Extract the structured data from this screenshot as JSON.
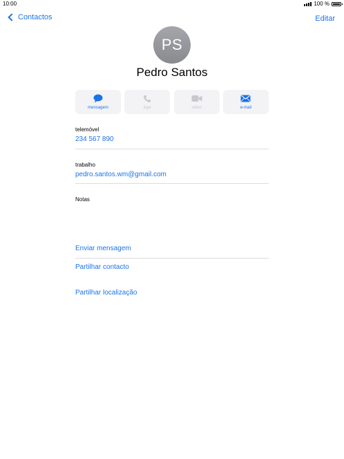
{
  "status_bar": {
    "time": "10:00",
    "battery": "100 %"
  },
  "nav": {
    "back_label": "Contactos",
    "edit_label": "Editar"
  },
  "contact": {
    "initials": "PS",
    "name": "Pedro Santos"
  },
  "actions": [
    {
      "label": "mensagem",
      "icon": "message-icon",
      "enabled": true
    },
    {
      "label": "ligar",
      "icon": "phone-icon",
      "enabled": false
    },
    {
      "label": "vídeo",
      "icon": "video-icon",
      "enabled": false
    },
    {
      "label": "e-mail",
      "icon": "mail-icon",
      "enabled": true
    }
  ],
  "fields": {
    "phone": {
      "label": "telemóvel",
      "value": "234 567 890"
    },
    "email": {
      "label": "trabalho",
      "value": "pedro.santos.wm@gmail.com"
    },
    "notes": {
      "label": "Notas"
    }
  },
  "links": {
    "send_message": "Enviar mensagem",
    "share_contact": "Partilhar contacto",
    "share_location": "Partilhar localização"
  },
  "colors": {
    "accent": "#1a73e8",
    "avatar": "#98999e",
    "action_bg": "#f3f3f5"
  }
}
